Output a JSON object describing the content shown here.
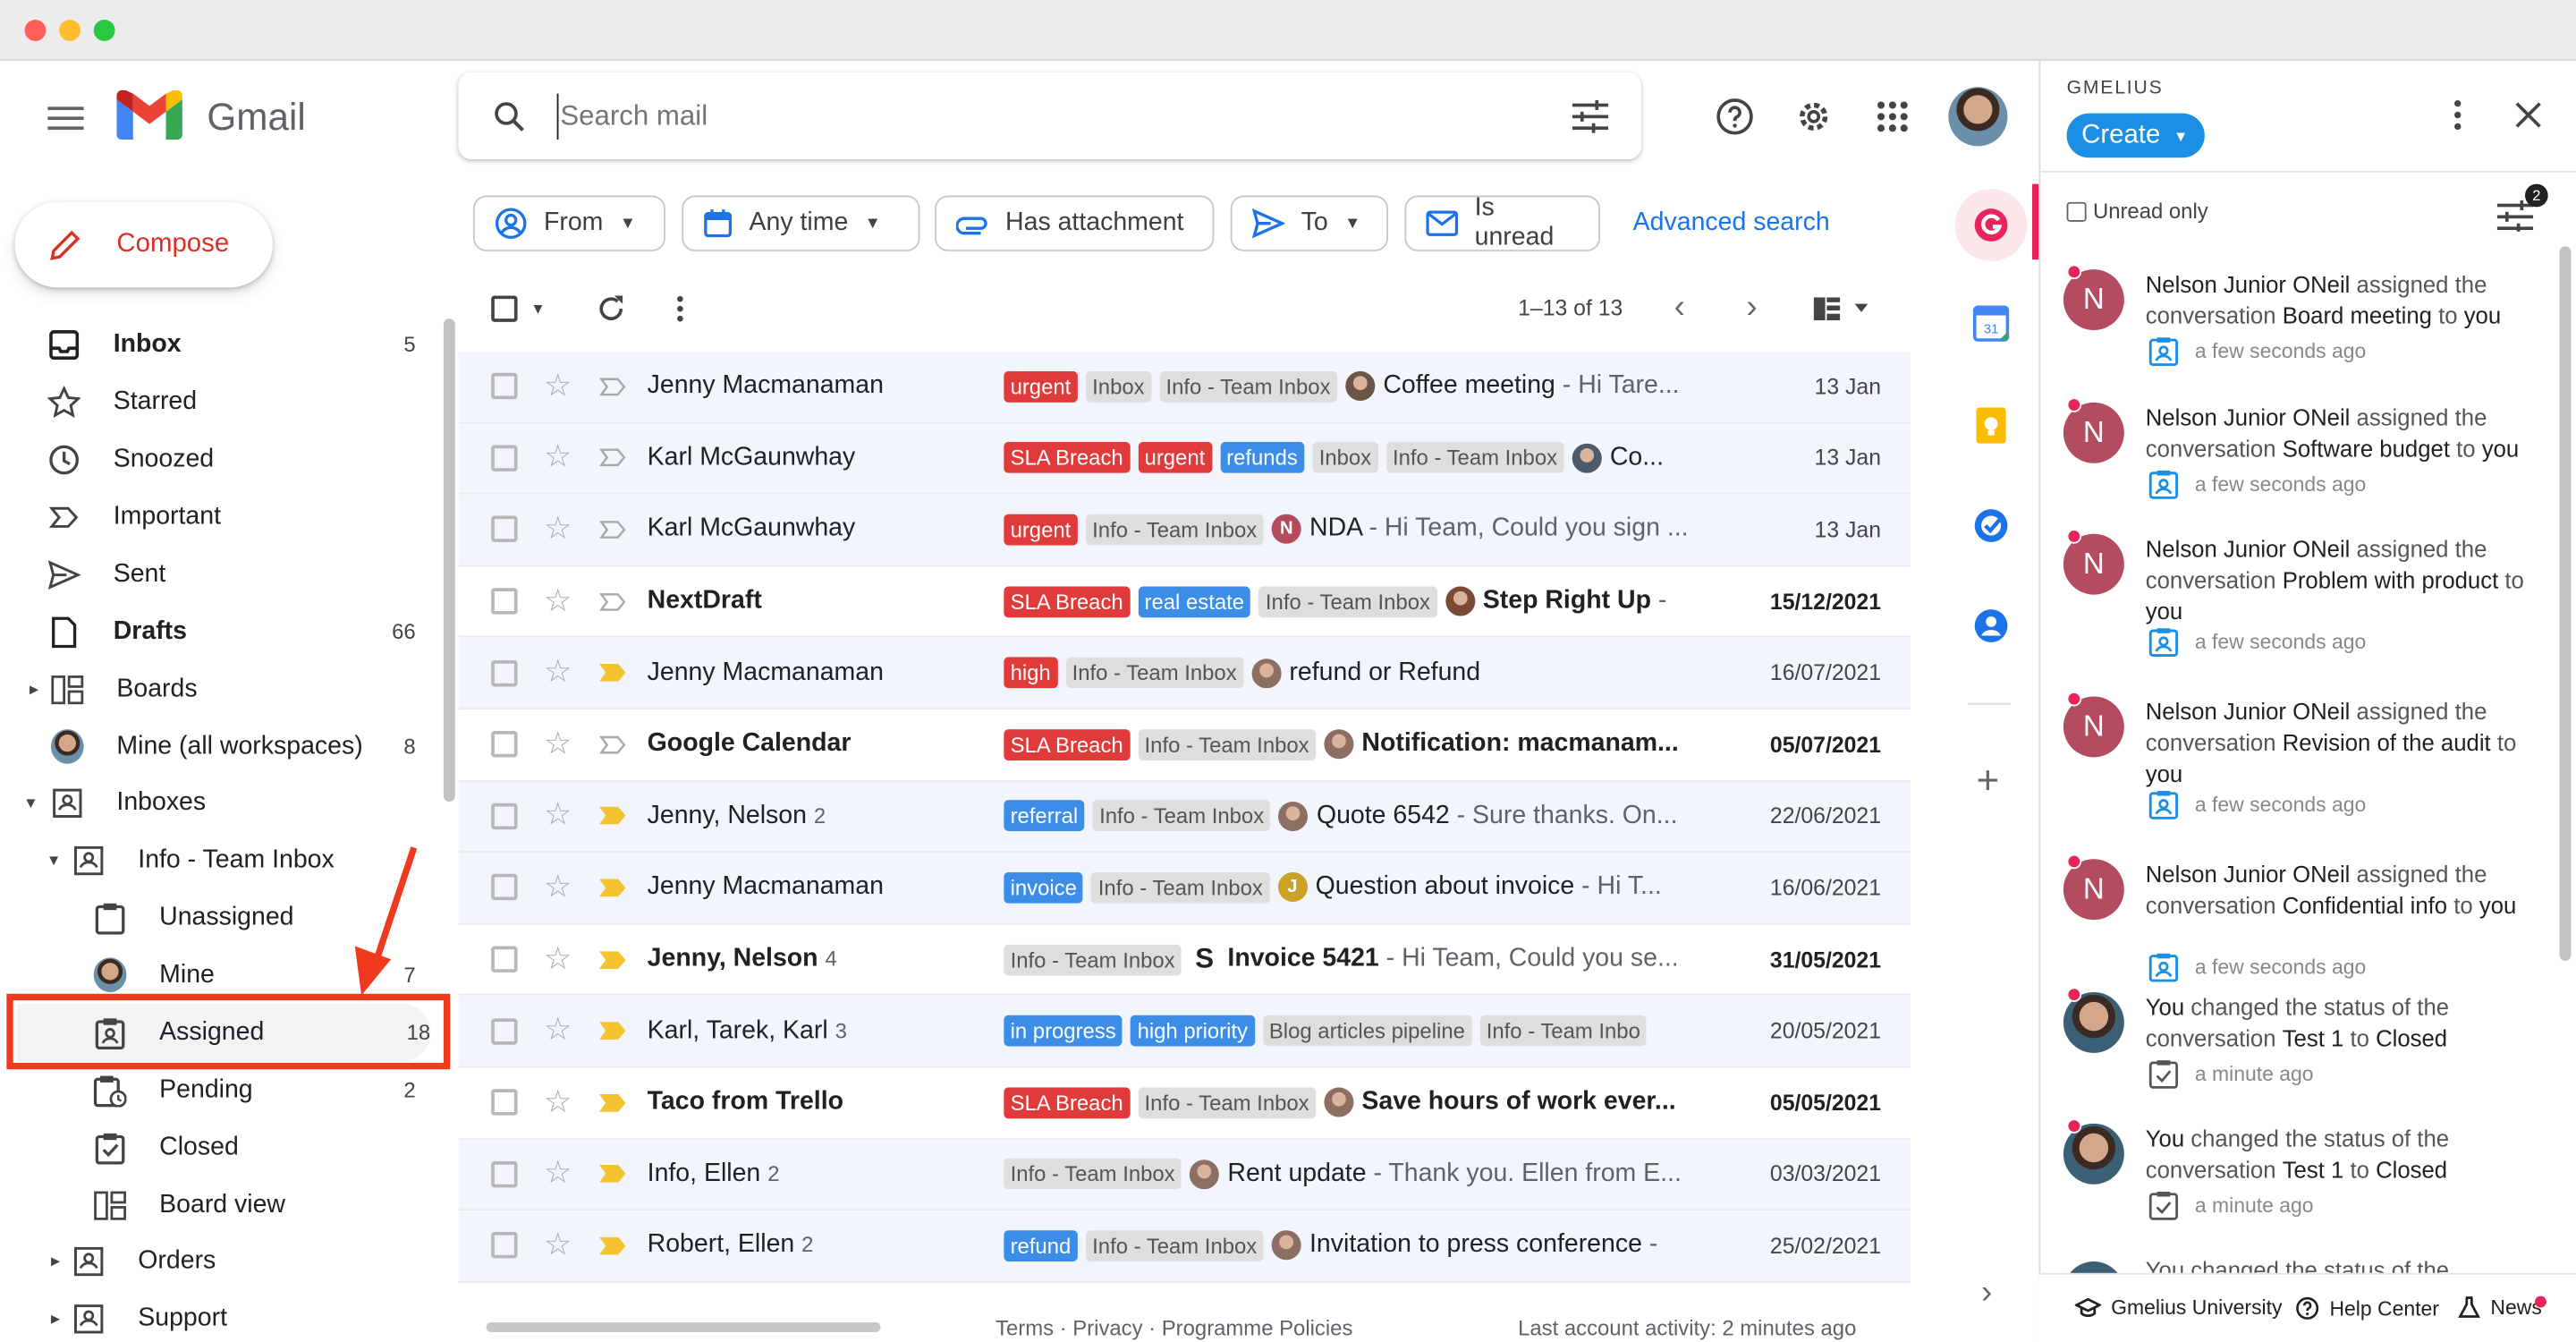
{
  "app": {
    "name": "Gmail",
    "compose": "Compose"
  },
  "search": {
    "placeholder": "Search mail"
  },
  "sidebar": {
    "items": [
      {
        "label": "Inbox",
        "count": "5",
        "bold": true
      },
      {
        "label": "Starred",
        "count": ""
      },
      {
        "label": "Snoozed",
        "count": ""
      },
      {
        "label": "Important",
        "count": ""
      },
      {
        "label": "Sent",
        "count": ""
      },
      {
        "label": "Drafts",
        "count": "66",
        "bold": true
      },
      {
        "label": "Boards",
        "count": ""
      },
      {
        "label": "Mine (all workspaces)",
        "count": "8"
      },
      {
        "label": "Inboxes",
        "count": ""
      },
      {
        "label": "Info - Team Inbox",
        "count": ""
      },
      {
        "label": "Unassigned",
        "count": ""
      },
      {
        "label": "Mine",
        "count": "7"
      },
      {
        "label": "Assigned",
        "count": "18"
      },
      {
        "label": "Pending",
        "count": "2"
      },
      {
        "label": "Closed",
        "count": ""
      },
      {
        "label": "Board view",
        "count": ""
      },
      {
        "label": "Orders",
        "count": ""
      },
      {
        "label": "Support",
        "count": ""
      }
    ]
  },
  "filters": {
    "from": "From",
    "any_time": "Any time",
    "has_attachment": "Has attachment",
    "to": "To",
    "is_unread": "Is unread",
    "advanced": "Advanced search"
  },
  "toolbar": {
    "pagination": "1–13 of 13"
  },
  "emails": [
    {
      "sender": "Jenny Macmanaman",
      "count": "",
      "unread": false,
      "important": false,
      "labels": [
        [
          "urgent",
          "red"
        ],
        [
          "Inbox",
          "gray"
        ],
        [
          "Info - Team Inbox",
          "gray"
        ]
      ],
      "avatar": "#6a5546",
      "subject": "Coffee meeting",
      "snippet": " - Hi Tare...",
      "date": "13 Jan"
    },
    {
      "sender": "Karl McGaunwhay",
      "count": "",
      "unread": false,
      "important": false,
      "labels": [
        [
          "SLA Breach",
          "red"
        ],
        [
          "urgent",
          "red"
        ],
        [
          "refunds",
          "blue"
        ],
        [
          "Inbox",
          "gray"
        ],
        [
          "Info - Team Inbox",
          "gray"
        ]
      ],
      "avatar": "#4d5a6b",
      "subject": "Co...",
      "snippet": "",
      "date": "13 Jan"
    },
    {
      "sender": "Karl McGaunwhay",
      "count": "",
      "unread": false,
      "important": false,
      "labels": [
        [
          "urgent",
          "red"
        ],
        [
          "Info - Team Inbox",
          "gray"
        ]
      ],
      "avatar": "#b34c5e",
      "avatar_letter": "N",
      "subject": "NDA",
      "snippet": " - Hi Team, Could you sign ...",
      "date": "13 Jan"
    },
    {
      "sender": "NextDraft",
      "count": "",
      "unread": true,
      "important": false,
      "labels": [
        [
          "SLA Breach",
          "red"
        ],
        [
          "real estate",
          "blue"
        ],
        [
          "Info - Team Inbox",
          "gray"
        ]
      ],
      "avatar": "#7a4a36",
      "subject": "Step Right Up",
      "snippet": " -",
      "date": "15/12/2021"
    },
    {
      "sender": "Jenny Macmanaman",
      "count": "",
      "unread": false,
      "important": true,
      "labels": [
        [
          "high",
          "red"
        ],
        [
          "Info - Team Inbox",
          "gray"
        ]
      ],
      "avatar": "#8d6e63",
      "subject": "refund or Refund",
      "snippet": "",
      "date": "16/07/2021"
    },
    {
      "sender": "Google Calendar",
      "count": "",
      "unread": true,
      "important": false,
      "labels": [
        [
          "SLA Breach",
          "red"
        ],
        [
          "Info - Team Inbox",
          "gray"
        ]
      ],
      "avatar": "#8d6e63",
      "subject": "Notification: macmanam...",
      "snippet": "",
      "date": "05/07/2021"
    },
    {
      "sender": "Jenny, Nelson",
      "count": "2",
      "unread": false,
      "important": true,
      "labels": [
        [
          "referral",
          "blue"
        ],
        [
          "Info - Team Inbox",
          "gray"
        ]
      ],
      "avatar": "#8d6e63",
      "subject": "Quote 6542",
      "snippet": " - Sure thanks. On...",
      "date": "22/06/2021"
    },
    {
      "sender": "Jenny Macmanaman",
      "count": "",
      "unread": false,
      "important": true,
      "labels": [
        [
          "invoice",
          "blue"
        ],
        [
          "Info - Team Inbox",
          "gray"
        ]
      ],
      "avatar": "#c9a227",
      "avatar_letter": "J",
      "subject": "Question about invoice",
      "snippet": " - Hi T...",
      "date": "16/06/2021"
    },
    {
      "sender": "Jenny, Nelson",
      "count": "4",
      "unread": true,
      "important": true,
      "labels": [
        [
          "Info - Team Inbox",
          "gray"
        ]
      ],
      "avatar": "#ffffff",
      "avatar_letter": "S",
      "subject": "Invoice 5421",
      "snippet": " - Hi Team, Could you se...",
      "date": "31/05/2021"
    },
    {
      "sender": "Karl, Tarek, Karl",
      "count": "3",
      "unread": false,
      "important": true,
      "labels": [
        [
          "in progress",
          "blue"
        ],
        [
          "high priority",
          "blue"
        ],
        [
          "Blog articles pipeline",
          "gray"
        ],
        [
          "Info - Team Inbo",
          "gray"
        ]
      ],
      "avatar": "",
      "subject": "",
      "snippet": "",
      "date": "20/05/2021"
    },
    {
      "sender": "Taco from Trello",
      "count": "",
      "unread": true,
      "important": true,
      "labels": [
        [
          "SLA Breach",
          "red"
        ],
        [
          "Info - Team Inbox",
          "gray"
        ]
      ],
      "avatar": "#8d6e63",
      "subject": "Save hours of work ever...",
      "snippet": "",
      "date": "05/05/2021"
    },
    {
      "sender": "Info, Ellen",
      "count": "2",
      "unread": false,
      "important": true,
      "labels": [
        [
          "Info - Team Inbox",
          "gray"
        ]
      ],
      "avatar": "#8d6e63",
      "subject": "Rent update",
      "snippet": " - Thank you. Ellen from E...",
      "date": "03/03/2021"
    },
    {
      "sender": "Robert, Ellen",
      "count": "2",
      "unread": false,
      "important": true,
      "labels": [
        [
          "refund",
          "blue"
        ],
        [
          "Info - Team Inbox",
          "gray"
        ]
      ],
      "avatar": "#8d6e63",
      "subject": "Invitation to press conference",
      "snippet": " -",
      "date": "25/02/2021"
    }
  ],
  "footer": {
    "links": "Terms · Privacy · Programme Policies",
    "activity": "Last account activity: 2 minutes ago"
  },
  "gmelius": {
    "brand": "GMELIUS",
    "create": "Create",
    "unread_only": "Unread only",
    "filter_badge": "2",
    "notifications": [
      {
        "pre": "Nelson Junior ONeil",
        "mid": " assigned the conversation ",
        "obj": "Board meeting",
        "post": " to ",
        "tail": "you",
        "time": "a few seconds ago",
        "type": "assign"
      },
      {
        "pre": "Nelson Junior ONeil",
        "mid": " assigned the conversation ",
        "obj": "Software budget",
        "post": " to ",
        "tail": "you",
        "time": "a few seconds ago",
        "type": "assign"
      },
      {
        "pre": "Nelson Junior ONeil",
        "mid": " assigned the conversation ",
        "obj": "Problem with product",
        "post": " to ",
        "tail": "you",
        "time": "a few seconds ago",
        "type": "assign"
      },
      {
        "pre": "Nelson Junior ONeil",
        "mid": " assigned the conversation ",
        "obj": "Revision of the audit",
        "post": " to ",
        "tail": "you",
        "time": "a few seconds ago",
        "type": "assign"
      },
      {
        "pre": "Nelson Junior ONeil",
        "mid": " assigned the conversation ",
        "obj": "Confidential info",
        "post": " to ",
        "tail": "you",
        "time": "a few seconds ago",
        "type": "assign"
      },
      {
        "pre": "You",
        "mid": " changed the status of the conversation ",
        "obj": "Test 1",
        "post": " to ",
        "tail": "Closed",
        "time": "a minute ago",
        "type": "status"
      },
      {
        "pre": "You",
        "mid": " changed the status of the conversation ",
        "obj": "Test 1",
        "post": " to ",
        "tail": "Closed",
        "time": "a minute ago",
        "type": "status"
      }
    ],
    "partial_text": "You changed the status of the",
    "bottom": {
      "university": "Gmelius University",
      "help": "Help Center",
      "news": "News"
    }
  }
}
